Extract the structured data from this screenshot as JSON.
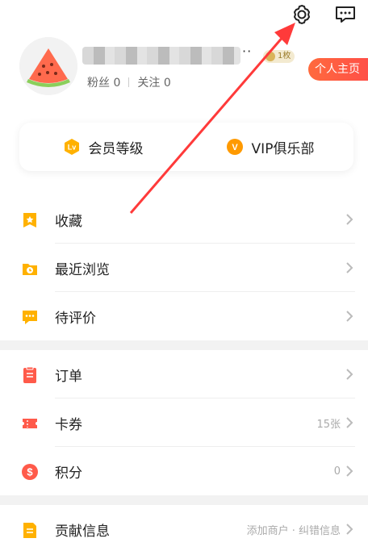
{
  "header": {
    "settings_icon": "gear-icon",
    "message_icon": "message-icon"
  },
  "profile": {
    "avatar_icon": "watermelon-avatar",
    "username_redacted": "",
    "coin_badge": "1枚",
    "fans_label": "粉丝",
    "fans_count": "0",
    "following_label": "关注",
    "following_count": "0",
    "homepage_button": "个人主页"
  },
  "member": {
    "level_label": "会员等级",
    "level_icon_text": "Lv",
    "vip_label": "VIP俱乐部",
    "vip_icon_text": "V"
  },
  "menu_group_1": [
    {
      "label": "收藏",
      "icon": "star-bookmark-icon",
      "value": ""
    },
    {
      "label": "最近浏览",
      "icon": "clock-folder-icon",
      "value": ""
    },
    {
      "label": "待评价",
      "icon": "comment-icon",
      "value": ""
    }
  ],
  "menu_group_2": [
    {
      "label": "订单",
      "icon": "clipboard-icon",
      "value": ""
    },
    {
      "label": "卡券",
      "icon": "ticket-icon",
      "value": "15张"
    },
    {
      "label": "积分",
      "icon": "dollar-coin-icon",
      "value": "0"
    }
  ],
  "menu_group_3": [
    {
      "label": "贡献信息",
      "icon": "document-icon",
      "value": "添加商户 · 纠错信息"
    }
  ],
  "colors": {
    "accent_orange": "#ffb100",
    "accent_red": "#ff4a4a",
    "annotation_arrow": "#ff3a3a"
  }
}
